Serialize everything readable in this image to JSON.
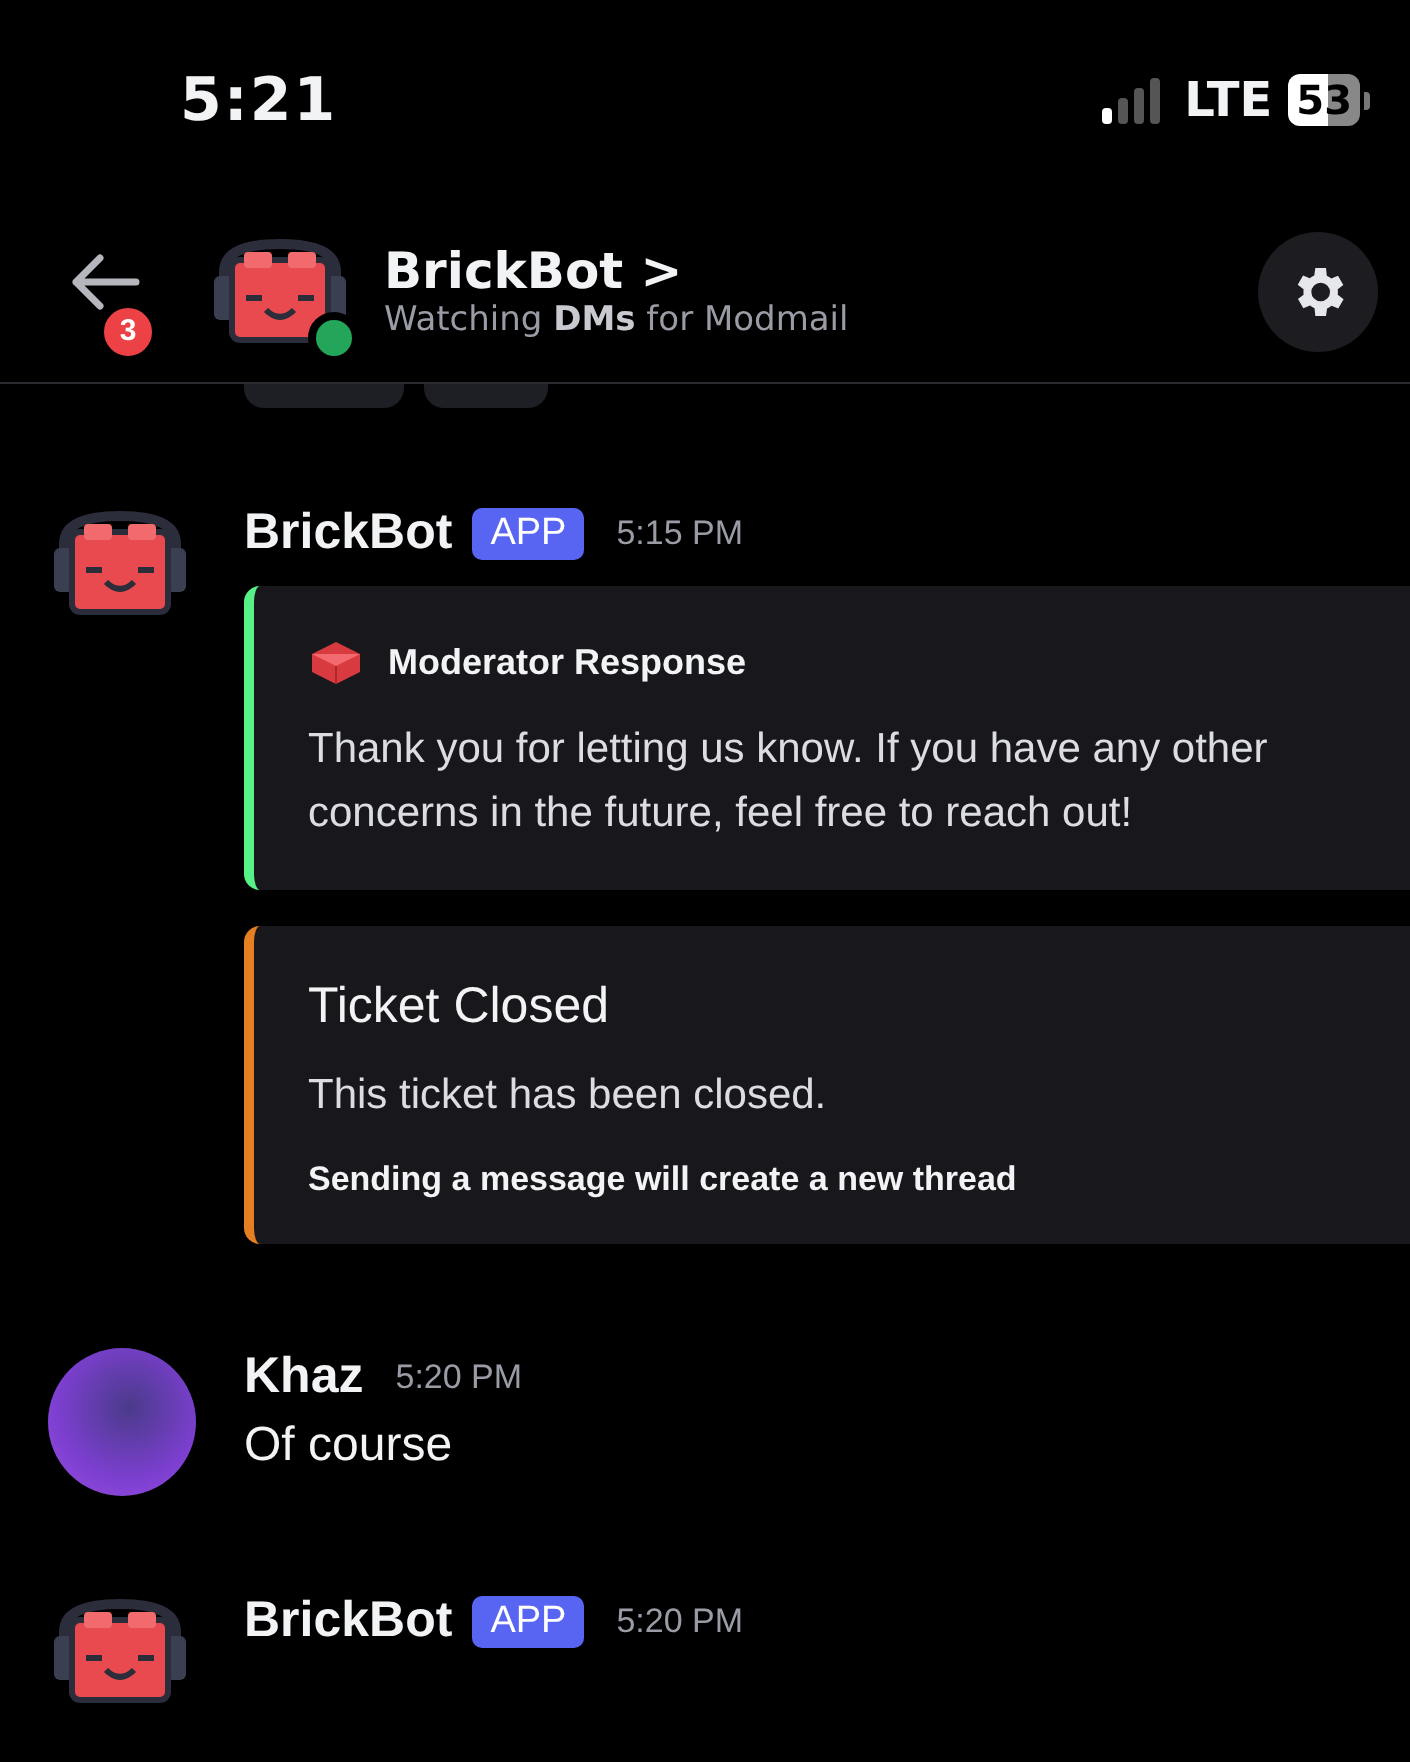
{
  "status_bar": {
    "time": "5:21",
    "network": "LTE",
    "battery": "53"
  },
  "header": {
    "unread_count": "3",
    "name": "BrickBot",
    "chevron": ">",
    "subtitle": "Watching **DMs** for Modmail",
    "online": true
  },
  "messages": [
    {
      "kind": "bot",
      "author": "BrickBot",
      "tag": "APP",
      "time": "5:15 PM",
      "embeds": [
        {
          "kind": "author",
          "color": "#57f287",
          "title": "Moderator Response",
          "description": "Thank you for letting us know. If you have any other concerns in the future, feel free to reach out!"
        },
        {
          "kind": "titled",
          "color": "#e67e22",
          "title": "Ticket Closed",
          "description": "This ticket has been closed.",
          "footer": "Sending a message will create a new thread"
        }
      ]
    },
    {
      "kind": "user",
      "author": "Khaz",
      "time": "5:20 PM",
      "text": "Of course"
    },
    {
      "kind": "bot",
      "author": "BrickBot",
      "tag": "APP",
      "time": "5:20 PM"
    }
  ]
}
